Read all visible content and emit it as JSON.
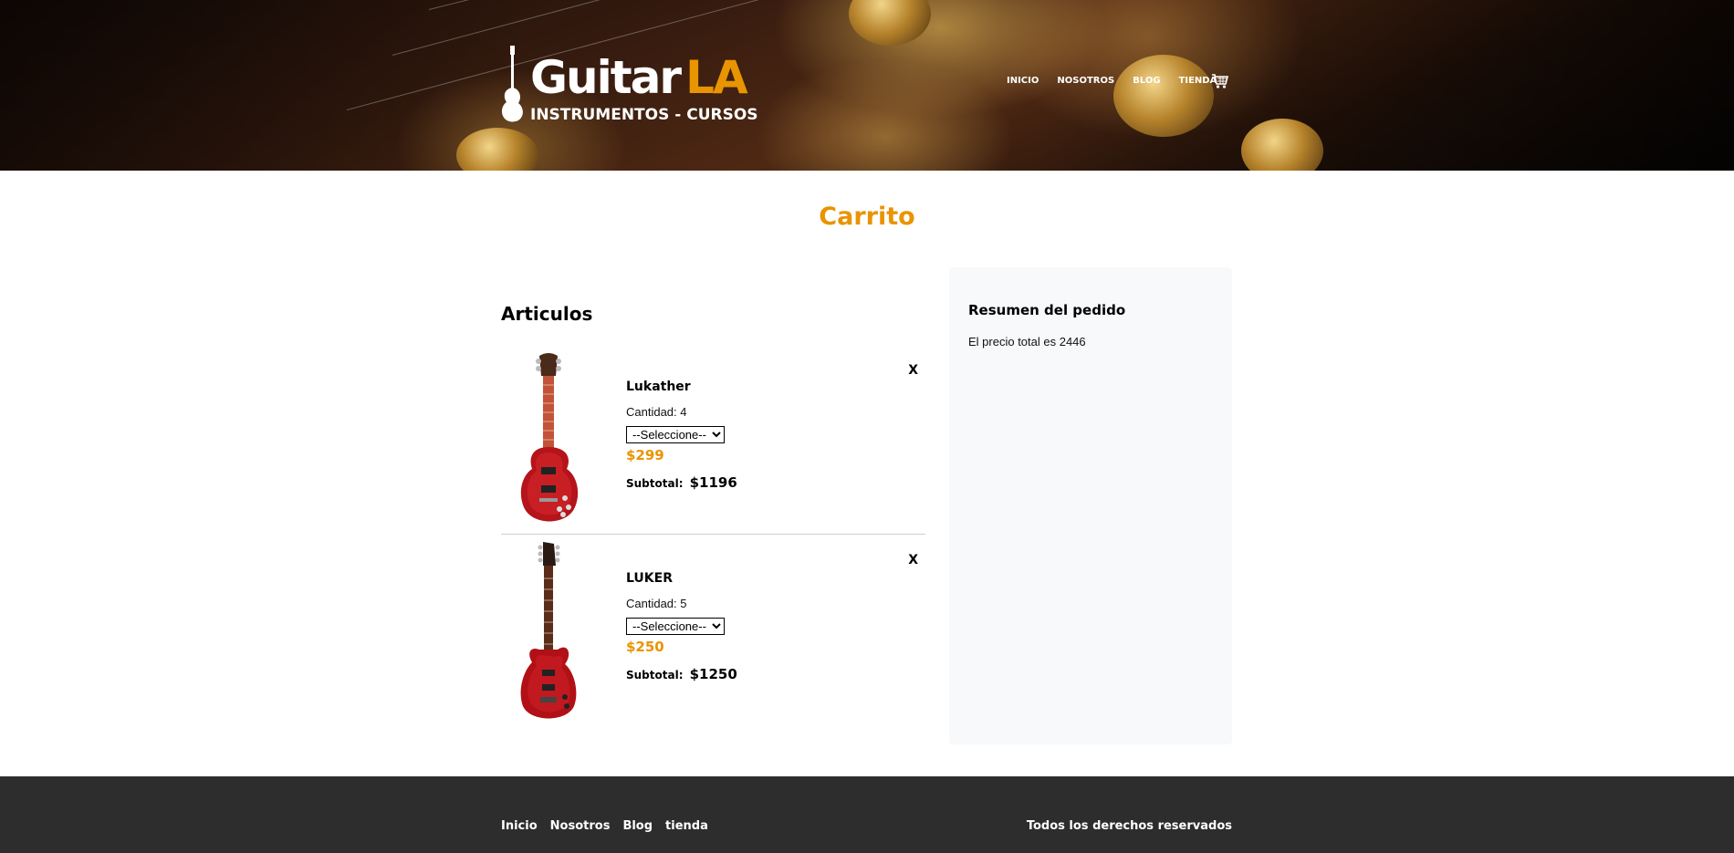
{
  "header": {
    "logo_word_1": "Guitar",
    "logo_word_2": "LA",
    "logo_subtitle": "INSTRUMENTOS - CURSOS",
    "nav": [
      "INICIO",
      "NOSOTROS",
      "BLOG",
      "TIENDA"
    ],
    "cart_icon": "shopping-cart-icon"
  },
  "main": {
    "page_title": "Carrito",
    "articles_title": "Articulos",
    "items": [
      {
        "name": "Lukather",
        "quantity_label": "Cantidad: 4",
        "select_value": "--Seleccione--",
        "price": "$299",
        "subtotal_label": "Subtotal:",
        "subtotal_value": "$1196",
        "remove_label": "X",
        "image_icon": "guitar-lespaul-image"
      },
      {
        "name": "LUKER",
        "quantity_label": "Cantidad: 5",
        "select_value": "--Seleccione--",
        "price": "$250",
        "subtotal_label": "Subtotal:",
        "subtotal_value": "$1250",
        "remove_label": "X",
        "image_icon": "guitar-superstrat-image"
      }
    ],
    "summary": {
      "title": "Resumen del pedido",
      "total_text": "El precio total es 2446"
    }
  },
  "footer": {
    "nav": [
      "Inicio",
      "Nosotros",
      "Blog",
      "tienda"
    ],
    "copyright": "Todos los derechos reservados"
  },
  "colors": {
    "accent": "#e99401",
    "footer_bg": "#2d2d2d",
    "summary_bg": "#f8f9fb"
  }
}
